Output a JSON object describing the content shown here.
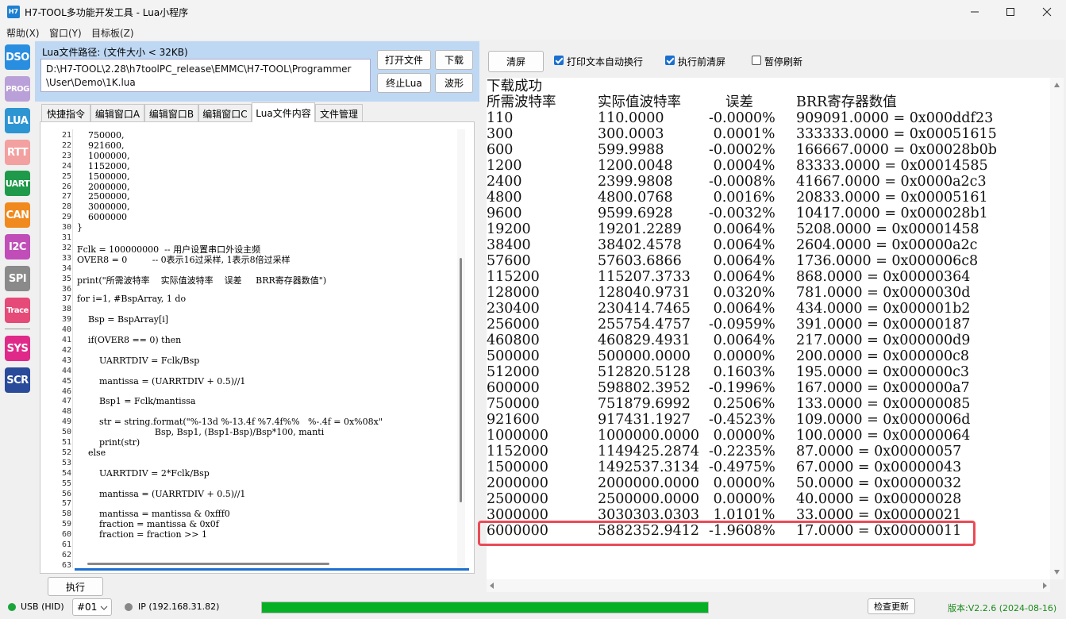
{
  "window": {
    "title": "H7-TOOL多功能开发工具 - Lua小程序",
    "icon_text": "H7"
  },
  "menu": [
    "帮助(X)",
    "窗口(Y)",
    "目标板(Z)"
  ],
  "sidebar": [
    {
      "label": "DSO",
      "color": "#2a8ee0"
    },
    {
      "label": "PROG",
      "color": "#b9a0d8"
    },
    {
      "label": "LUA",
      "color": "#2e95d3"
    },
    {
      "label": "RTT",
      "color": "#f2a0a0"
    },
    {
      "label": "UART",
      "color": "#1f9a4a"
    },
    {
      "label": "CAN",
      "color": "#f08a1e"
    },
    {
      "label": "I2C",
      "color": "#c04db8"
    },
    {
      "label": "SPI",
      "color": "#8a8a8a"
    },
    {
      "label": "Trace",
      "color": "#e54a78"
    },
    {
      "label": "SYS",
      "color": "#e02a8a"
    },
    {
      "label": "SCR",
      "color": "#2a4a9a"
    }
  ],
  "lua": {
    "path_label": "Lua文件路径: (文件大小 < 32KB)",
    "path_line1": "D:\\H7-TOOL\\2.28\\h7toolPC_release\\EMMC\\H7-TOOL\\Programmer",
    "path_line2": "\\User\\Demo\\1K.lua",
    "open_btn": "打开文件",
    "download_btn": "下载",
    "stop_btn": "终止Lua",
    "wave_btn": "波形"
  },
  "tabs": [
    "快捷指令",
    "编辑窗口A",
    "编辑窗口B",
    "编辑窗口C",
    "Lua文件内容",
    "文件管理"
  ],
  "code_lines": [
    {
      "n": "21",
      "t": "    750000,"
    },
    {
      "n": "22",
      "t": "    921600,"
    },
    {
      "n": "23",
      "t": "    1000000,"
    },
    {
      "n": "24",
      "t": "    1152000,"
    },
    {
      "n": "25",
      "t": "    1500000,"
    },
    {
      "n": "26",
      "t": "    2000000,"
    },
    {
      "n": "27",
      "t": "    2500000,"
    },
    {
      "n": "28",
      "t": "    3000000,"
    },
    {
      "n": "29",
      "t": "    6000000"
    },
    {
      "n": "30",
      "t": "}"
    },
    {
      "n": "31",
      "t": ""
    },
    {
      "n": "32",
      "t": "Fclk = 100000000  -- 用户设置串口外设主频"
    },
    {
      "n": "33",
      "t": "OVER8 = 0         -- 0表示16过采样, 1表示8倍过采样"
    },
    {
      "n": "34",
      "t": ""
    },
    {
      "n": "35",
      "t": "print(\"所需波特率    实际值波特率    误差     BRR寄存器数值\")"
    },
    {
      "n": "36",
      "t": ""
    },
    {
      "n": "37",
      "t": "for i=1, #BspArray, 1 do"
    },
    {
      "n": "38",
      "t": ""
    },
    {
      "n": "39",
      "t": "    Bsp = BspArray[i]"
    },
    {
      "n": "40",
      "t": ""
    },
    {
      "n": "41",
      "t": "    if(OVER8 == 0) then"
    },
    {
      "n": "42",
      "t": ""
    },
    {
      "n": "43",
      "t": "        UARRTDIV = Fclk/Bsp"
    },
    {
      "n": "44",
      "t": ""
    },
    {
      "n": "45",
      "t": "        mantissa = (UARRTDIV + 0.5)//1"
    },
    {
      "n": "46",
      "t": ""
    },
    {
      "n": "47",
      "t": "        Bsp1 = Fclk/mantissa"
    },
    {
      "n": "48",
      "t": ""
    },
    {
      "n": "49",
      "t": "        str = string.format(\"%-13d %-13.4f %7.4f%%   %-.4f = 0x%08x\""
    },
    {
      "n": "50",
      "t": "                            Bsp, Bsp1, (Bsp1-Bsp)/Bsp*100, manti"
    },
    {
      "n": "51",
      "t": "        print(str)"
    },
    {
      "n": "52",
      "t": "    else"
    },
    {
      "n": "53",
      "t": ""
    },
    {
      "n": "54",
      "t": "        UARRTDIV = 2*Fclk/Bsp"
    },
    {
      "n": "55",
      "t": ""
    },
    {
      "n": "56",
      "t": "        mantissa = (UARRTDIV + 0.5)//1"
    },
    {
      "n": "57",
      "t": ""
    },
    {
      "n": "58",
      "t": "        mantissa = mantissa & 0xfff0"
    },
    {
      "n": "59",
      "t": "        fraction = mantissa & 0x0f"
    },
    {
      "n": "60",
      "t": "        fraction = fraction >> 1"
    },
    {
      "n": "61",
      "t": ""
    },
    {
      "n": "62",
      "t": ""
    },
    {
      "n": "63",
      "t": ""
    }
  ],
  "run_btn": "执行",
  "output_toolbar": {
    "clear_btn": "清屏",
    "wrap_label": "打印文本自动换行",
    "clear_before_label": "执行前清屏",
    "pause_label": "暂停刷新"
  },
  "output": {
    "status": "下载成功",
    "headers": [
      "所需波特率",
      "实际值波特率",
      "误差",
      "BRR寄存器数值"
    ],
    "rows": [
      [
        "110",
        "110.0000",
        "-0.0000%",
        "909091.0000 = 0x000ddf23"
      ],
      [
        "300",
        "300.0003",
        " 0.0001%",
        "333333.0000 = 0x00051615"
      ],
      [
        "600",
        "599.9988",
        "-0.0002%",
        "166667.0000 = 0x00028b0b"
      ],
      [
        "1200",
        "1200.0048",
        " 0.0004%",
        "83333.0000 = 0x00014585"
      ],
      [
        "2400",
        "2399.9808",
        "-0.0008%",
        "41667.0000 = 0x0000a2c3"
      ],
      [
        "4800",
        "4800.0768",
        " 0.0016%",
        "20833.0000 = 0x00005161"
      ],
      [
        "9600",
        "9599.6928",
        "-0.0032%",
        "10417.0000 = 0x000028b1"
      ],
      [
        "19200",
        "19201.2289",
        " 0.0064%",
        "5208.0000 = 0x00001458"
      ],
      [
        "38400",
        "38402.4578",
        " 0.0064%",
        "2604.0000 = 0x00000a2c"
      ],
      [
        "57600",
        "57603.6866",
        " 0.0064%",
        "1736.0000 = 0x000006c8"
      ],
      [
        "115200",
        "115207.3733",
        " 0.0064%",
        "868.0000 = 0x00000364"
      ],
      [
        "128000",
        "128040.9731",
        " 0.0320%",
        "781.0000 = 0x0000030d"
      ],
      [
        "230400",
        "230414.7465",
        " 0.0064%",
        "434.0000 = 0x000001b2"
      ],
      [
        "256000",
        "255754.4757",
        "-0.0959%",
        "391.0000 = 0x00000187"
      ],
      [
        "460800",
        "460829.4931",
        " 0.0064%",
        "217.0000 = 0x000000d9"
      ],
      [
        "500000",
        "500000.0000",
        " 0.0000%",
        "200.0000 = 0x000000c8"
      ],
      [
        "512000",
        "512820.5128",
        " 0.1603%",
        "195.0000 = 0x000000c3"
      ],
      [
        "600000",
        "598802.3952",
        "-0.1996%",
        "167.0000 = 0x000000a7"
      ],
      [
        "750000",
        "751879.6992",
        " 0.2506%",
        "133.0000 = 0x00000085"
      ],
      [
        "921600",
        "917431.1927",
        "-0.4523%",
        "109.0000 = 0x0000006d"
      ],
      [
        "1000000",
        "1000000.0000",
        " 0.0000%",
        "100.0000 = 0x00000064"
      ],
      [
        "1152000",
        "1149425.2874",
        "-0.2235%",
        "87.0000 = 0x00000057"
      ],
      [
        "1500000",
        "1492537.3134",
        "-0.4975%",
        "67.0000 = 0x00000043"
      ],
      [
        "2000000",
        "2000000.0000",
        " 0.0000%",
        "50.0000 = 0x00000032"
      ],
      [
        "2500000",
        "2500000.0000",
        " 0.0000%",
        "40.0000 = 0x00000028"
      ],
      [
        "3000000",
        "3030303.0303",
        " 1.0101%",
        "33.0000 = 0x00000021"
      ],
      [
        "6000000",
        "5882352.9412",
        "-1.9608%",
        "17.0000 = 0x00000011"
      ]
    ]
  },
  "status": {
    "usb": "USB (HID)",
    "device": "#01",
    "ip": "IP (192.168.31.82)",
    "progress": 1.0,
    "check_update": "检查更新",
    "version": "版本:V2.2.6 (2024-08-16)"
  },
  "colors": {
    "accent": "#1e6fd0",
    "highlight": "#e94b56",
    "progress": "#06b025",
    "version": "#1a8a1a"
  }
}
